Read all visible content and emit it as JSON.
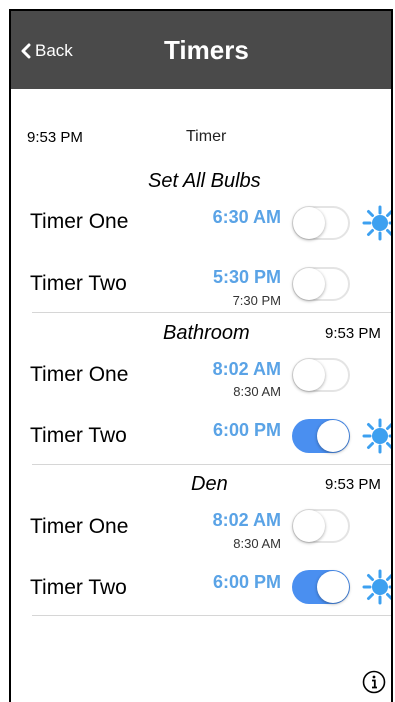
{
  "nav": {
    "back_label": "Back",
    "title": "Timers"
  },
  "header": {
    "clock": "9:53 PM",
    "column_label": "Timer"
  },
  "groups": [
    {
      "title": "Set All Bulbs",
      "clock": "",
      "rows": [
        {
          "label": "Timer One",
          "time": "6:30 AM",
          "subtime": "",
          "toggle": "off",
          "sun": true
        },
        {
          "label": "Timer Two",
          "time": "5:30 PM",
          "subtime": "7:30 PM",
          "toggle": "off",
          "sun": false
        }
      ]
    },
    {
      "title": "Bathroom",
      "clock": "9:53 PM",
      "rows": [
        {
          "label": "Timer One",
          "time": "8:02 AM",
          "subtime": "8:30 AM",
          "toggle": "off",
          "sun": false
        },
        {
          "label": "Timer Two",
          "time": "6:00 PM",
          "subtime": "",
          "toggle": "on",
          "sun": true
        }
      ]
    },
    {
      "title": "Den",
      "clock": "9:53 PM",
      "rows": [
        {
          "label": "Timer One",
          "time": "8:02 AM",
          "subtime": "8:30 AM",
          "toggle": "off",
          "sun": false
        },
        {
          "label": "Timer Two",
          "time": "6:00 PM",
          "subtime": "",
          "toggle": "on",
          "sun": true
        }
      ]
    }
  ],
  "colors": {
    "navbar": "#4a4a4a",
    "time_accent": "#5aa3e6",
    "toggle_on": "#4a8ff0",
    "sun": "#3da0f0"
  },
  "icons": {
    "back": "chevron-left-icon",
    "sun": "sun-icon",
    "info": "info-icon"
  }
}
